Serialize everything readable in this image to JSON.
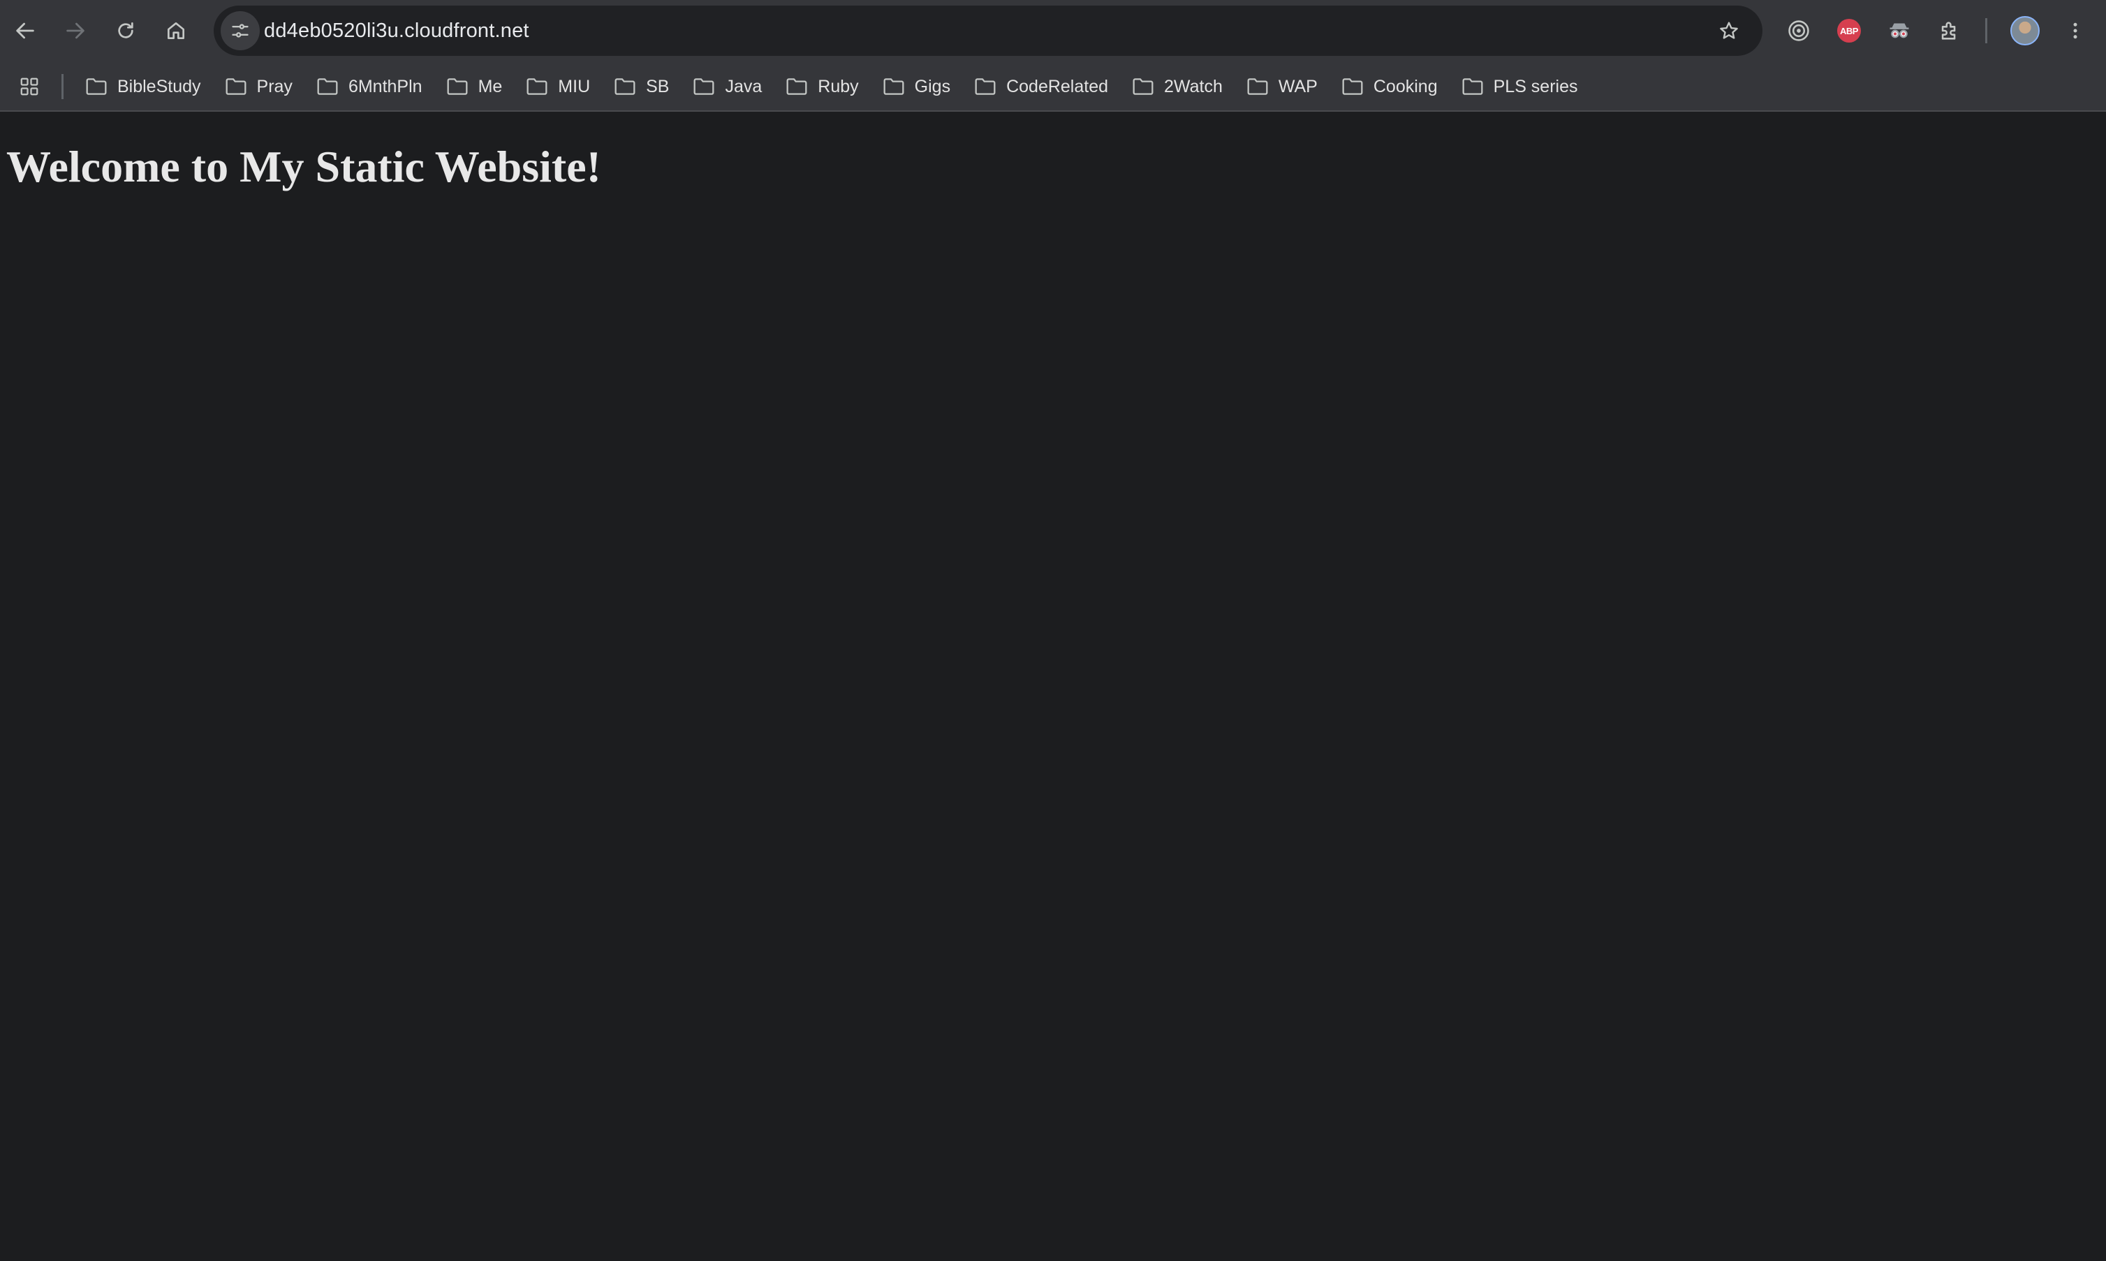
{
  "toolbar": {
    "back": "back-arrow-icon",
    "forward": "forward-arrow-icon",
    "reload": "reload-icon",
    "home": "home-icon",
    "url": "dd4eb0520li3u.cloudfront.net",
    "star": "star-icon",
    "extensions": [
      "target-icon",
      "adblock-icon",
      "spy-glasses-icon",
      "puzzle-icon"
    ],
    "abp_label": "ABP",
    "menu": "kebab-menu-icon"
  },
  "bookmarks": [
    {
      "label": "BibleStudy"
    },
    {
      "label": "Pray"
    },
    {
      "label": "6MnthPln"
    },
    {
      "label": "Me"
    },
    {
      "label": "MIU"
    },
    {
      "label": "SB"
    },
    {
      "label": "Java"
    },
    {
      "label": "Ruby"
    },
    {
      "label": "Gigs"
    },
    {
      "label": "CodeRelated"
    },
    {
      "label": "2Watch"
    },
    {
      "label": "WAP"
    },
    {
      "label": "Cooking"
    },
    {
      "label": "PLS series"
    }
  ],
  "page": {
    "heading": "Welcome to My Static Website!"
  },
  "colors": {
    "toolbar_bg": "#35363a",
    "omnibox_bg": "#202124",
    "page_bg": "#1c1d1f",
    "text": "#e8eaed",
    "abp_red": "#d63f4f"
  }
}
